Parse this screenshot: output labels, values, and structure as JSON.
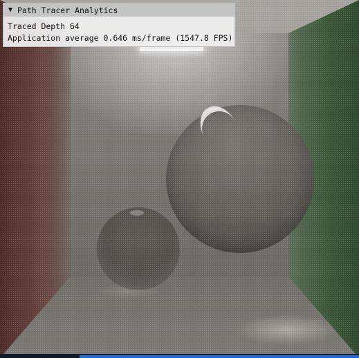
{
  "window": {
    "title": "Path Tracer Analytics",
    "collapse_icon": "triangle-down-icon",
    "traced_depth_line": "Traced Depth 64",
    "app_average_line": "Application average 0.646 ms/frame (1547.8 FPS)"
  },
  "scene": {
    "left_wall_color": "#5e3d38",
    "right_wall_color": "#3e5a3a",
    "accent_color": "#1f6fd6"
  }
}
